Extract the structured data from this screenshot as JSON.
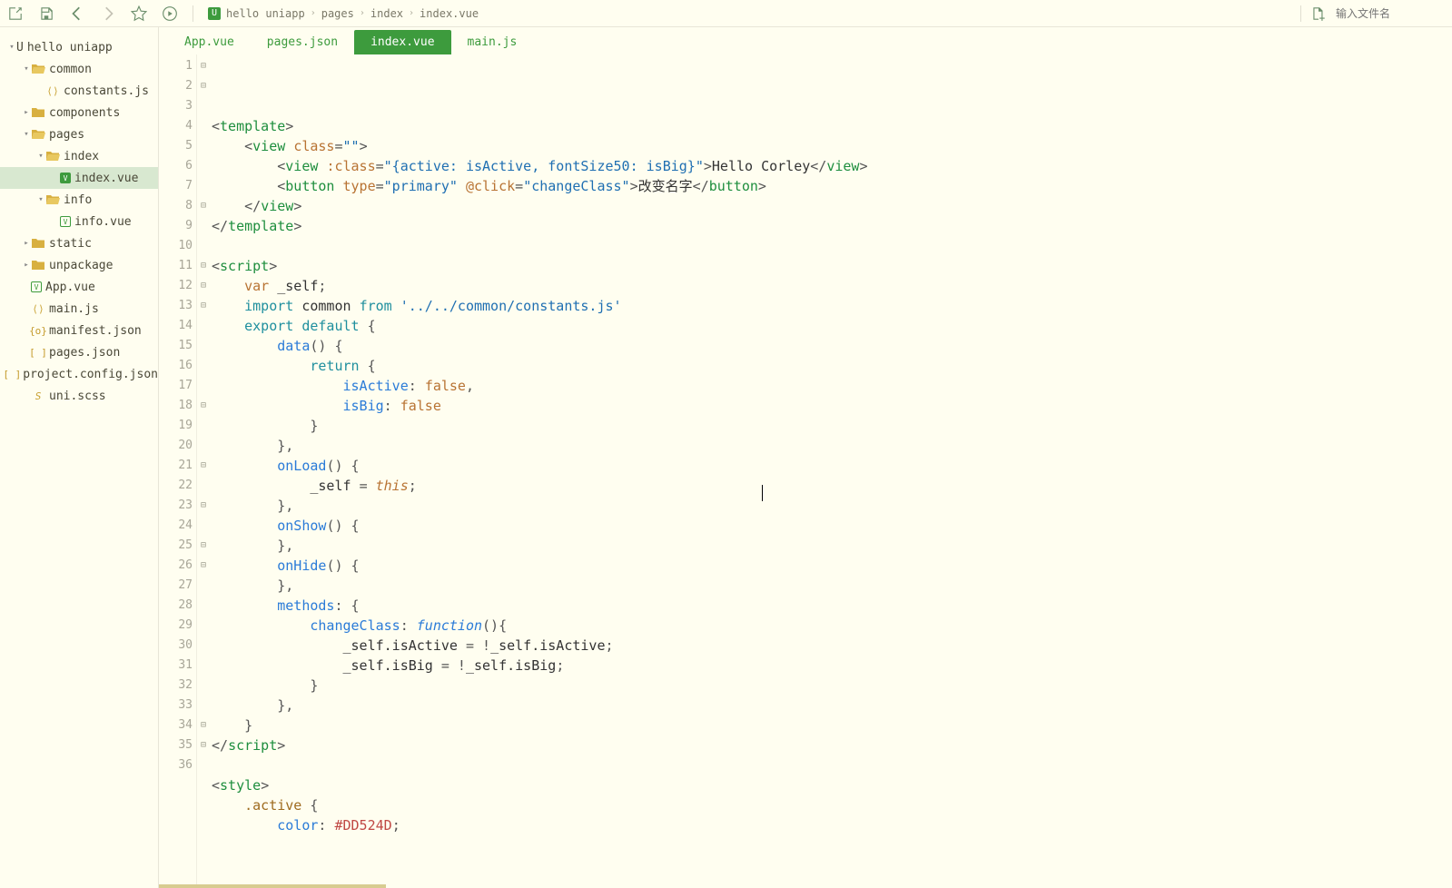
{
  "toolbar": {
    "search_placeholder": "输入文件名"
  },
  "breadcrumb": [
    "hello uniapp",
    "pages",
    "index",
    "index.vue"
  ],
  "tree": [
    {
      "indent": 0,
      "arrow": "down",
      "icon": "folder-open",
      "file_icon": "U",
      "label": "hello uniapp",
      "sel": false
    },
    {
      "indent": 1,
      "arrow": "down",
      "icon": "folder-open",
      "label": "common",
      "sel": false
    },
    {
      "indent": 2,
      "arrow": "",
      "icon": "js",
      "label": "constants.js",
      "sel": false
    },
    {
      "indent": 1,
      "arrow": "right",
      "icon": "folder",
      "label": "components",
      "sel": false
    },
    {
      "indent": 1,
      "arrow": "down",
      "icon": "folder-open",
      "label": "pages",
      "sel": false
    },
    {
      "indent": 2,
      "arrow": "down",
      "icon": "folder-open",
      "label": "index",
      "sel": false
    },
    {
      "indent": 3,
      "arrow": "",
      "icon": "vue-sel",
      "label": "index.vue",
      "sel": true
    },
    {
      "indent": 2,
      "arrow": "down",
      "icon": "folder-open",
      "label": "info",
      "sel": false
    },
    {
      "indent": 3,
      "arrow": "",
      "icon": "vue",
      "label": "info.vue",
      "sel": false
    },
    {
      "indent": 1,
      "arrow": "right",
      "icon": "folder",
      "label": "static",
      "sel": false
    },
    {
      "indent": 1,
      "arrow": "right",
      "icon": "folder",
      "label": "unpackage",
      "sel": false
    },
    {
      "indent": 1,
      "arrow": "",
      "icon": "vue",
      "label": "App.vue",
      "sel": false
    },
    {
      "indent": 1,
      "arrow": "",
      "icon": "js",
      "label": "main.js",
      "sel": false
    },
    {
      "indent": 1,
      "arrow": "",
      "icon": "json",
      "label": "manifest.json",
      "sel": false
    },
    {
      "indent": 1,
      "arrow": "",
      "icon": "json-outline",
      "label": "pages.json",
      "sel": false
    },
    {
      "indent": 1,
      "arrow": "",
      "icon": "json-outline",
      "label": "project.config.json",
      "sel": false
    },
    {
      "indent": 1,
      "arrow": "",
      "icon": "scss",
      "label": "uni.scss",
      "sel": false
    }
  ],
  "tabs": [
    {
      "label": "App.vue",
      "active": false
    },
    {
      "label": "pages.json",
      "active": false
    },
    {
      "label": "index.vue",
      "active": true
    },
    {
      "label": "main.js",
      "active": false
    }
  ],
  "code": {
    "line1_tag": "template",
    "line2_tag": "view",
    "line2_attr": "class",
    "line2_val": "\"\"",
    "line3_tag": "view",
    "line3_attr": ":class",
    "line3_val": "\"{active: isActive, fontSize50: isBig}\"",
    "line3_text": "Hello Corley",
    "line4_tag": "button",
    "line4_attr1": "type",
    "line4_val1": "\"primary\"",
    "line4_attr2": "@click",
    "line4_val2": "\"changeClass\"",
    "line4_text": "改变名字",
    "line8_tag": "script",
    "line9_kw": "var",
    "line9_name": "_self",
    "line10_kw": "import",
    "line10_name": "common",
    "line10_from": "from",
    "line10_path": "'../../common/constants.js'",
    "line11_kw": "export",
    "line11_kw2": "default",
    "line12_name": "data",
    "line13_kw": "return",
    "line14_prop": "isActive",
    "line14_val": "false",
    "line15_prop": "isBig",
    "line15_val": "false",
    "line18_name": "onLoad",
    "line19_name": "_self",
    "line19_this": "this",
    "line21_name": "onShow",
    "line23_name": "onHide",
    "line25_name": "methods",
    "line26_name": "changeClass",
    "line26_func": "function",
    "line27_l": "_self.isActive",
    "line27_r": "_self.isActive",
    "line28_l": "_self.isBig",
    "line28_r": "_self.isBig",
    "line34_tag": "style",
    "line35_sel": ".active",
    "line36_prop": "color",
    "line36_val": "#DD524D"
  },
  "line_numbers": [
    1,
    2,
    3,
    4,
    5,
    6,
    7,
    8,
    9,
    10,
    11,
    12,
    13,
    14,
    15,
    16,
    17,
    18,
    19,
    20,
    21,
    22,
    23,
    24,
    25,
    26,
    27,
    28,
    29,
    30,
    31,
    32,
    33,
    34,
    35,
    36
  ],
  "fold_markers": {
    "1": "⊟",
    "2": "⊟",
    "8": "⊟",
    "11": "⊟",
    "12": "⊟",
    "13": "⊟",
    "18": "⊟",
    "21": "⊟",
    "23": "⊟",
    "25": "⊟",
    "26": "⊟",
    "34": "⊟",
    "35": "⊟"
  }
}
